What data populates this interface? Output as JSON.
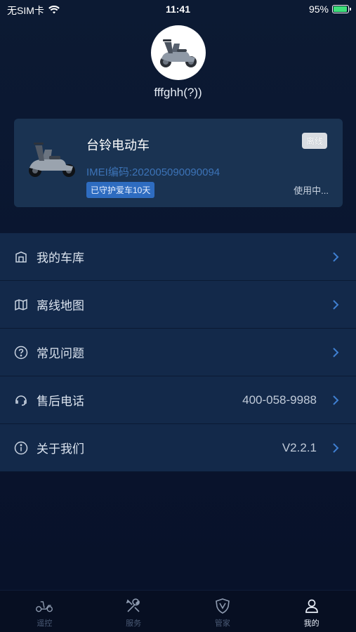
{
  "status_bar": {
    "carrier": "无SIM卡",
    "time": "11:41",
    "battery": "95%",
    "battery_level": 0.95
  },
  "profile": {
    "username": "fffghh(?))"
  },
  "vehicle": {
    "name": "台铃电动车",
    "status": "离线",
    "imei": "IMEI编码:202005090090094",
    "guard_badge": "已守护爱车10天",
    "usage": "使用中..."
  },
  "menu": [
    {
      "label": "我的车库",
      "value": "",
      "icon": "garage-icon"
    },
    {
      "label": "离线地图",
      "value": "",
      "icon": "map-icon"
    },
    {
      "label": "常见问题",
      "value": "",
      "icon": "question-icon"
    },
    {
      "label": "售后电话",
      "value": "400-058-9988",
      "icon": "headset-icon"
    },
    {
      "label": "关于我们",
      "value": "V2.2.1",
      "icon": "info-icon"
    }
  ],
  "tabs": [
    {
      "label": "遥控",
      "icon": "scooter-icon",
      "active": false
    },
    {
      "label": "服务",
      "icon": "tools-icon",
      "active": false
    },
    {
      "label": "管家",
      "icon": "shield-icon",
      "active": false
    },
    {
      "label": "我的",
      "icon": "user-icon",
      "active": true
    }
  ],
  "colors": {
    "accent": "#3c73b7",
    "card_bg": "#1a3352",
    "menu_bg": "#13294a"
  }
}
